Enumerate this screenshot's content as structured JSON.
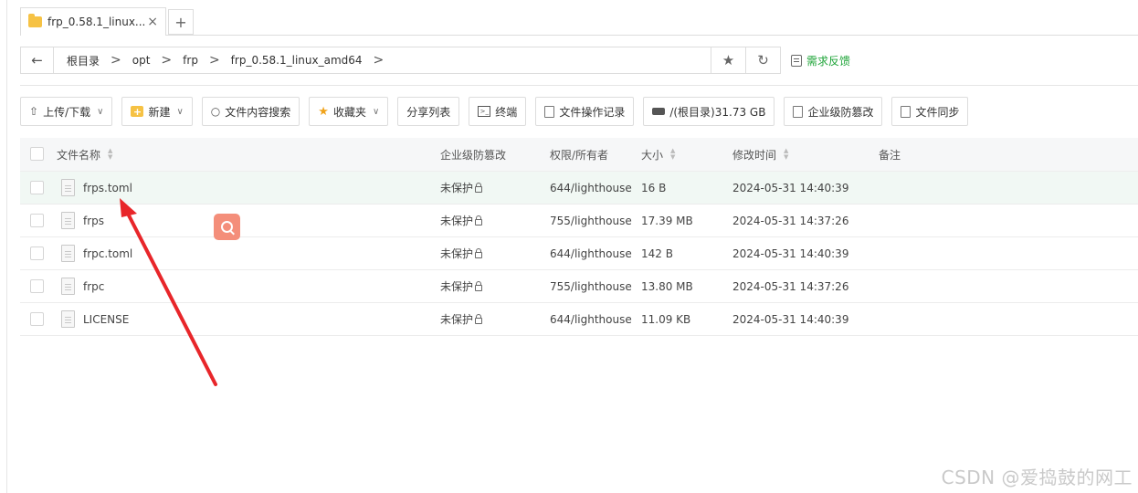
{
  "tab": {
    "title": "frp_0.58.1_linux...",
    "close": "×",
    "new": "+"
  },
  "address": {
    "back": "←",
    "crumbs": [
      "根目录",
      "opt",
      "frp",
      "frp_0.58.1_linux_amd64"
    ],
    "separator": ">",
    "star": "★",
    "refresh": "↻"
  },
  "feedback": "需求反馈",
  "toolbar": {
    "upload": "上传/下载",
    "new": "新建",
    "content_search": "文件内容搜索",
    "favorites": "收藏夹",
    "share_list": "分享列表",
    "terminal": "终端",
    "op_log": "文件操作记录",
    "disk": "/(根目录)31.73 GB",
    "tamper": "企业级防篡改",
    "sync": "文件同步"
  },
  "table": {
    "headers": {
      "name": "文件名称",
      "tamper": "企业级防篡改",
      "perm": "权限/所有者",
      "size": "大小",
      "mtime": "修改时间",
      "note": "备注"
    },
    "rows": [
      {
        "name": "frps.toml",
        "tamper": "未保护",
        "perm": "644/lighthouse",
        "size": "16 B",
        "mtime": "2024-05-31 14:40:39"
      },
      {
        "name": "frps",
        "tamper": "未保护",
        "perm": "755/lighthouse",
        "size": "17.39 MB",
        "mtime": "2024-05-31 14:37:26"
      },
      {
        "name": "frpc.toml",
        "tamper": "未保护",
        "perm": "644/lighthouse",
        "size": "142 B",
        "mtime": "2024-05-31 14:40:39"
      },
      {
        "name": "frpc",
        "tamper": "未保护",
        "perm": "755/lighthouse",
        "size": "13.80 MB",
        "mtime": "2024-05-31 14:37:26"
      },
      {
        "name": "LICENSE",
        "tamper": "未保护",
        "perm": "644/lighthouse",
        "size": "11.09 KB",
        "mtime": "2024-05-31 14:40:39"
      }
    ]
  },
  "colors": {
    "accent_green": "#20a53a",
    "annotation_red": "#e8262a",
    "search_badge": "#f48e7a"
  },
  "watermark": "CSDN @爱捣鼓的网工"
}
